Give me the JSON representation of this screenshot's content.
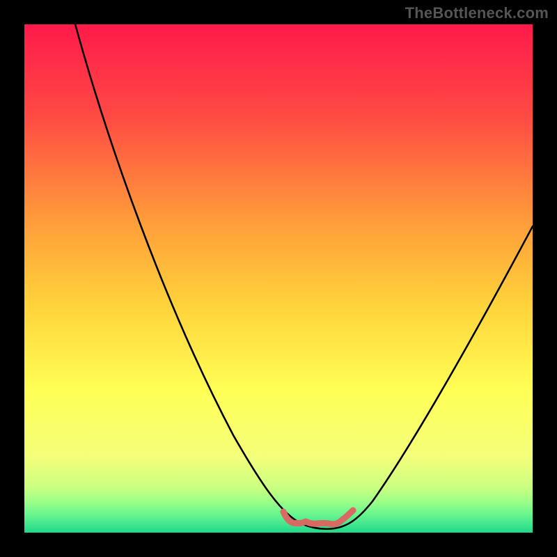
{
  "watermark": "TheBottleneck.com",
  "colors": {
    "frame": "#000000",
    "gradient_top": "#ff1a4a",
    "gradient_mid_upper": "#ff7a3a",
    "gradient_mid": "#ffd23a",
    "gradient_mid_lower": "#f8ff4a",
    "gradient_green1": "#b8ff6a",
    "gradient_green2": "#5aff8a",
    "gradient_green3": "#20e08a",
    "curve": "#000000",
    "marker_band": "#d96a63"
  },
  "chart_data": {
    "type": "line",
    "title": "",
    "xlabel": "",
    "ylabel": "",
    "xlim": [
      0,
      100
    ],
    "ylim": [
      0,
      100
    ],
    "grid": false,
    "legend": false,
    "series": [
      {
        "name": "bottleneck-curve",
        "x": [
          10,
          15,
          20,
          25,
          30,
          35,
          40,
          45,
          50,
          52,
          55,
          58,
          60,
          63,
          65,
          70,
          75,
          80,
          85,
          90,
          95,
          100
        ],
        "y": [
          100,
          88,
          76,
          64,
          53,
          42,
          32,
          22,
          12,
          7,
          3,
          1,
          1,
          1,
          3,
          8,
          15,
          23,
          32,
          41,
          50,
          60
        ]
      },
      {
        "name": "optimal-band",
        "x": [
          52,
          55,
          58,
          60,
          63,
          65
        ],
        "y": [
          4,
          2,
          1,
          1,
          2,
          4
        ]
      }
    ],
    "annotations": []
  }
}
